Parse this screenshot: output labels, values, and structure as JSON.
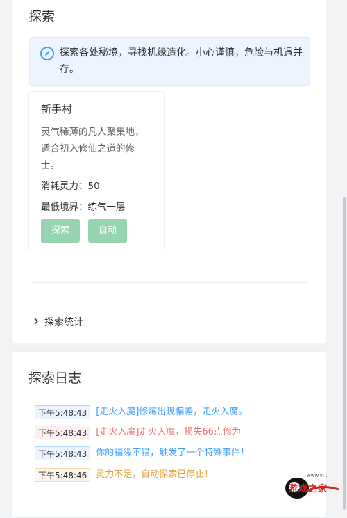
{
  "explore": {
    "title": "探索",
    "notice": "探索各处秘境，寻找机缘造化。小心谨慎，危险与机遇并存。",
    "locations": [
      {
        "name": "新手村",
        "description": "灵气稀薄的凡人聚集地，适合初入修仙之道的修士。",
        "cost": "消耗灵力：50",
        "min_realm": "最低境界：练气一层",
        "explore_label": "探索",
        "auto_label": "自动"
      }
    ],
    "stats_label": "探索统计"
  },
  "log": {
    "title": "探索日志",
    "entries": [
      {
        "time": "下午5:48:43",
        "text": "[走火入魔]修炼出现偏差，走火入魔。",
        "type": "blue"
      },
      {
        "time": "下午5:48:43",
        "text": "[走火入魔]走火入魔，损失66点修为",
        "type": "red"
      },
      {
        "time": "下午5:48:43",
        "text": "你的福缘不错，触发了一个特殊事件！",
        "type": "blue"
      },
      {
        "time": "下午5:48:46",
        "text": "灵力不足，自动探索已停止！",
        "type": "orange"
      }
    ]
  },
  "watermark": {
    "text": "游戏之家",
    "small": "www.y…"
  },
  "colors": {
    "primary": "#409eff",
    "success_disabled": "#95d4af",
    "danger": "#f56c6c",
    "warning": "#e6a23c"
  },
  "icons": [
    "compass-icon",
    "chevron-right-icon"
  ]
}
